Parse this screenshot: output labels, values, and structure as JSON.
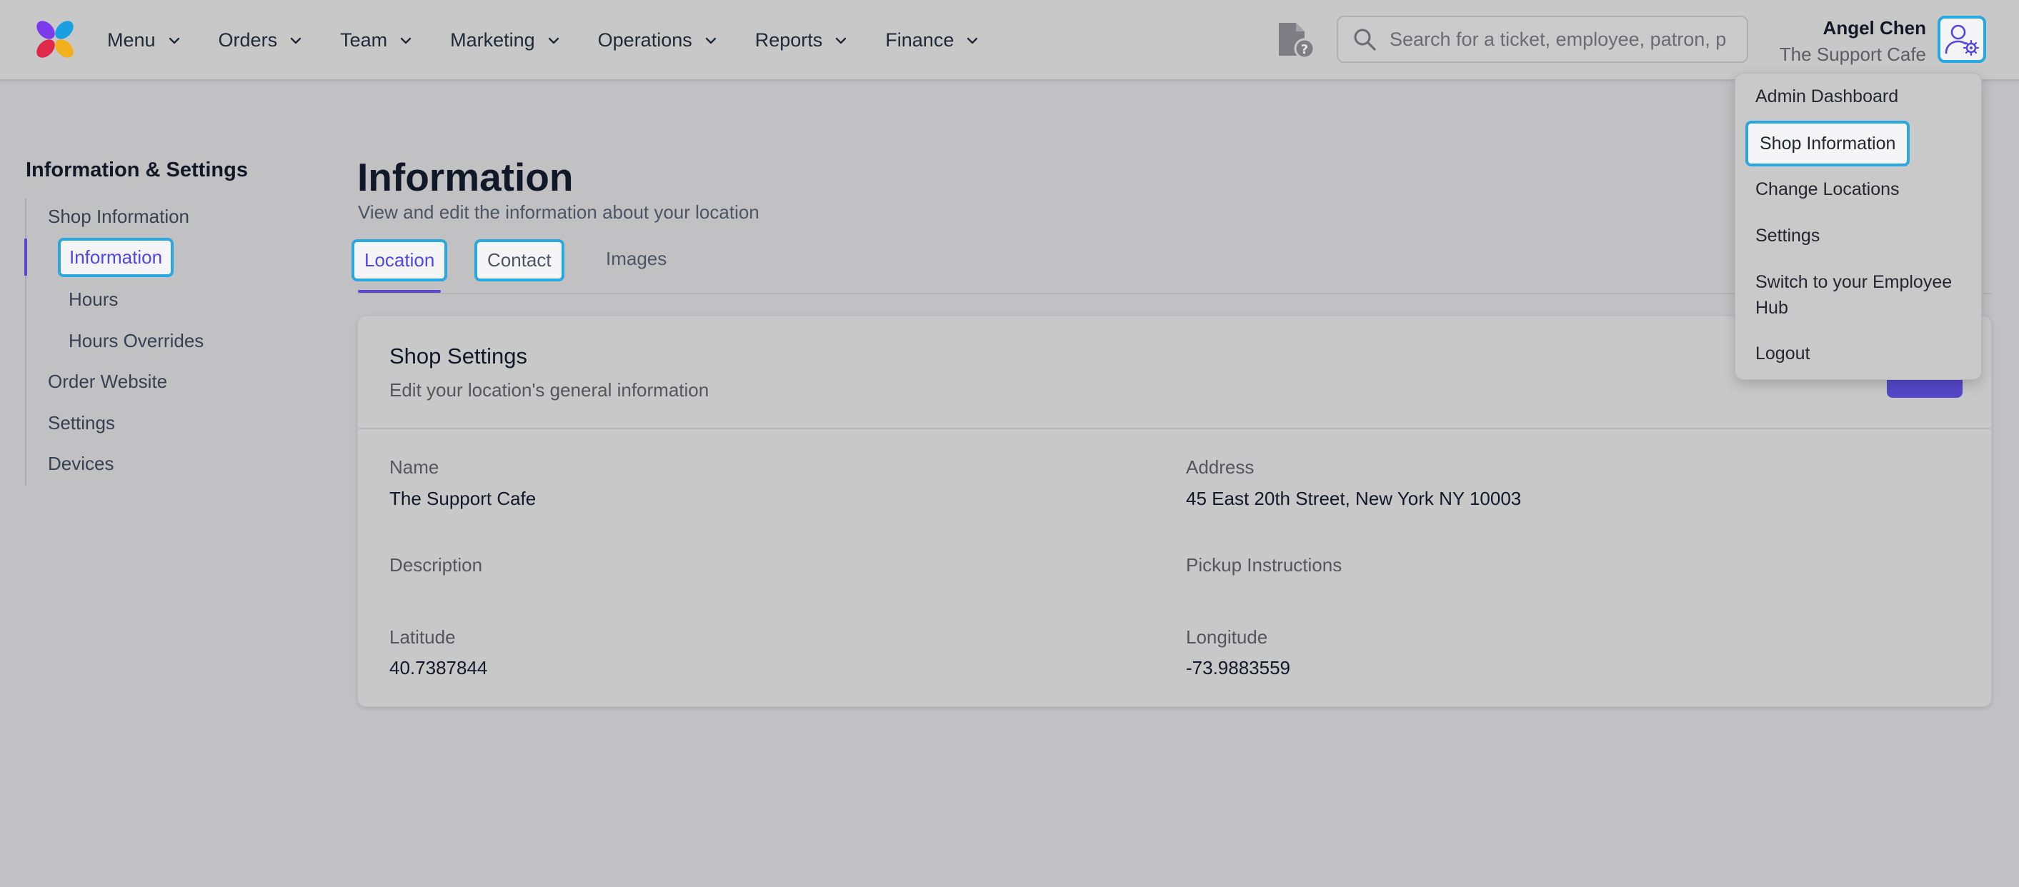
{
  "nav": {
    "items": [
      {
        "label": "Menu"
      },
      {
        "label": "Orders"
      },
      {
        "label": "Team"
      },
      {
        "label": "Marketing"
      },
      {
        "label": "Operations"
      },
      {
        "label": "Reports"
      },
      {
        "label": "Finance"
      }
    ]
  },
  "search": {
    "placeholder": "Search for a ticket, employee, patron, p"
  },
  "user": {
    "name": "Angel Chen",
    "shop": "The Support Cafe"
  },
  "user_menu": {
    "items": [
      {
        "label": "Admin Dashboard"
      },
      {
        "label": "Shop Information"
      },
      {
        "label": "Change Locations"
      },
      {
        "label": "Settings"
      },
      {
        "label": "Switch to your Employee Hub"
      },
      {
        "label": "Logout"
      }
    ],
    "active_index": 1
  },
  "sidebar": {
    "title": "Information & Settings",
    "items": [
      {
        "label": "Shop Information"
      },
      {
        "label": "Information"
      },
      {
        "label": "Hours"
      },
      {
        "label": "Hours Overrides"
      },
      {
        "label": "Order Website"
      },
      {
        "label": "Settings"
      },
      {
        "label": "Devices"
      }
    ]
  },
  "page": {
    "title": "Information",
    "subtitle": "View and edit the information about your location"
  },
  "tabs": [
    {
      "label": "Location"
    },
    {
      "label": "Contact"
    },
    {
      "label": "Images"
    }
  ],
  "card": {
    "title": "Shop Settings",
    "subtitle": "Edit your location's general information",
    "fields": {
      "name": {
        "label": "Name",
        "value": "The Support Cafe"
      },
      "address": {
        "label": "Address",
        "value": "45 East 20th Street, New York NY 10003"
      },
      "description": {
        "label": "Description",
        "value": ""
      },
      "pickup": {
        "label": "Pickup Instructions",
        "value": ""
      },
      "latitude": {
        "label": "Latitude",
        "value": "40.7387844"
      },
      "longitude": {
        "label": "Longitude",
        "value": "-73.9883559"
      }
    }
  },
  "colors": {
    "accent": "#5b49c9",
    "highlight_outline": "#29a8e0"
  },
  "icons": {
    "logo": "app-logo",
    "help": "document-help-icon",
    "search": "search-icon",
    "avatar": "user-settings-icon",
    "chevron": "chevron-down-icon"
  }
}
